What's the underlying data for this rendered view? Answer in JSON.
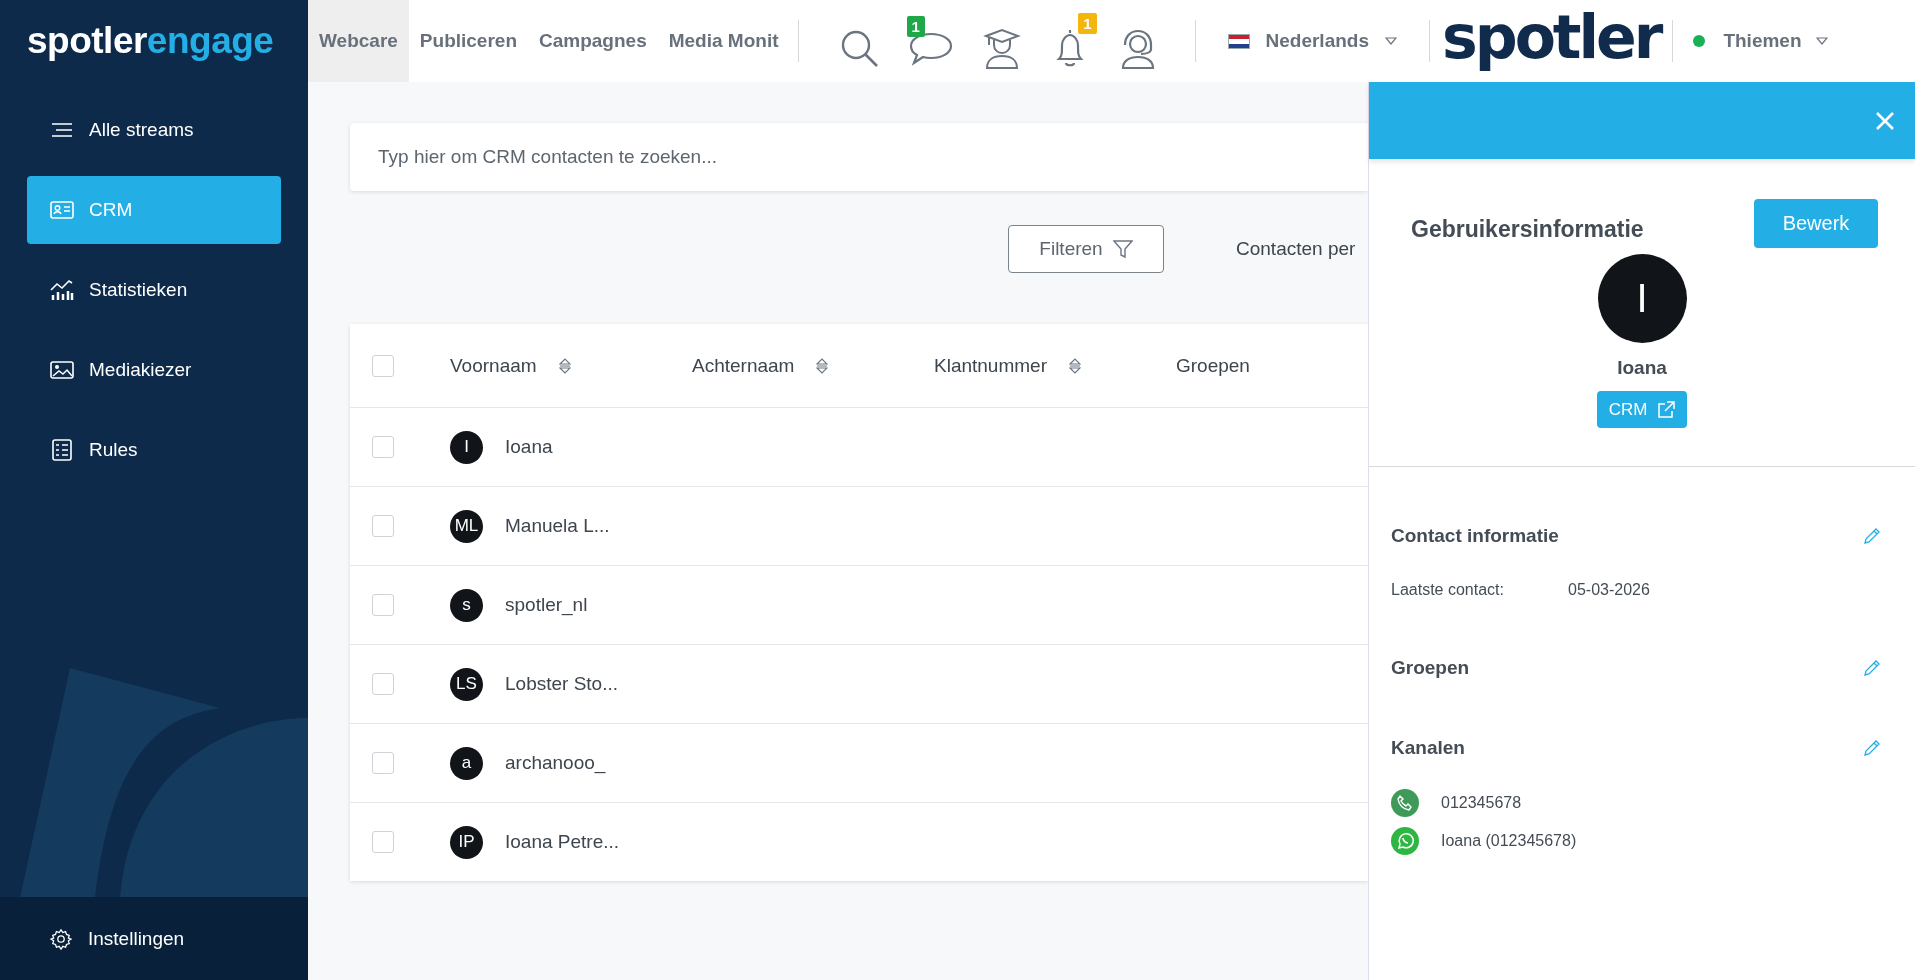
{
  "logo": {
    "part_1": "spotler",
    "part_2": "engage"
  },
  "nav_tabs": [
    {
      "label": "Webcare",
      "selected": true
    },
    {
      "label": "Publiceren",
      "selected": false
    },
    {
      "label": "Campagnes",
      "selected": false
    },
    {
      "label": "Media Monit",
      "selected": false
    }
  ],
  "top_icons": [
    {
      "kind": "search"
    },
    {
      "kind": "chat",
      "badge": "1",
      "color": "#1ea84a"
    },
    {
      "kind": "academy"
    },
    {
      "kind": "bell",
      "badge": "1",
      "color": "#f5b50f"
    },
    {
      "kind": "support"
    }
  ],
  "language": {
    "label": "Nederlands"
  },
  "brand": "spotler",
  "user": {
    "name": "Thiemen",
    "online": true
  },
  "sidebar": {
    "items": [
      {
        "label": "Alle streams",
        "selected": false
      },
      {
        "label": "CRM",
        "selected": true
      },
      {
        "label": "Statistieken",
        "selected": false
      },
      {
        "label": "Mediakiezer",
        "selected": false
      },
      {
        "label": "Rules",
        "selected": false
      }
    ],
    "footer": {
      "label": "Instellingen"
    }
  },
  "search": {
    "placeholder": "Typ hier om CRM contacten te zoeken..."
  },
  "filter_button": "Filteren",
  "per_page_label": "Contacten per",
  "table": {
    "all_checked": false,
    "columns": [
      {
        "label": "Voornaam",
        "sortable": true
      },
      {
        "label": "Achternaam",
        "sortable": true
      },
      {
        "label": "Klantnummer",
        "sortable": true
      },
      {
        "label": "Groepen",
        "sortable": false
      }
    ],
    "rows": [
      {
        "initials": "I",
        "voornaam": "Ioana",
        "checked": false
      },
      {
        "initials": "ML",
        "voornaam": "Manuela L...",
        "checked": false
      },
      {
        "initials": "s",
        "voornaam": "spotler_nl",
        "checked": false
      },
      {
        "initials": "LS",
        "voornaam": "Lobster Sto...",
        "checked": false
      },
      {
        "initials": "a",
        "voornaam": "archanooo_",
        "checked": false
      },
      {
        "initials": "IP",
        "voornaam": "Ioana Petre...",
        "checked": false
      }
    ]
  },
  "panel": {
    "title": "Gebruikersinformatie",
    "edit_button": "Bewerk",
    "avatar_initial": "I",
    "name": "Ioana",
    "crm_button": "CRM",
    "contact": {
      "title": "Contact informatie",
      "fields": [
        {
          "label": "Laatste contact:",
          "value": "05-03-2026"
        }
      ]
    },
    "groups": {
      "title": "Groepen"
    },
    "channels": {
      "title": "Kanalen",
      "items": [
        {
          "kind": "phone",
          "value": "012345678"
        },
        {
          "kind": "whatsapp",
          "value": "Ioana (012345678)"
        }
      ]
    }
  }
}
